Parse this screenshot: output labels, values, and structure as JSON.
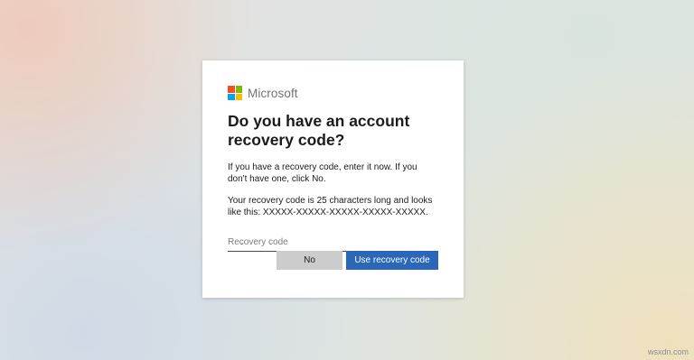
{
  "brand": {
    "name": "Microsoft",
    "logo_colors": [
      "#f25022",
      "#7fba00",
      "#00a4ef",
      "#ffb900"
    ]
  },
  "dialog": {
    "title": "Do you have an account recovery code?",
    "paragraph1": "If you have a recovery code, enter it now. If you don't have one, click No.",
    "paragraph2": "Your recovery code is 25 characters long and looks like this: XXXXX-XXXXX-XXXXX-XXXXX-XXXXX.",
    "input": {
      "value": "",
      "placeholder": "Recovery code"
    },
    "buttons": {
      "no_label": "No",
      "primary_label": "Use recovery code"
    }
  },
  "watermark": "wsxdn.com",
  "colors": {
    "primary_button": "#2a67b8",
    "secondary_button": "#cccccc"
  }
}
